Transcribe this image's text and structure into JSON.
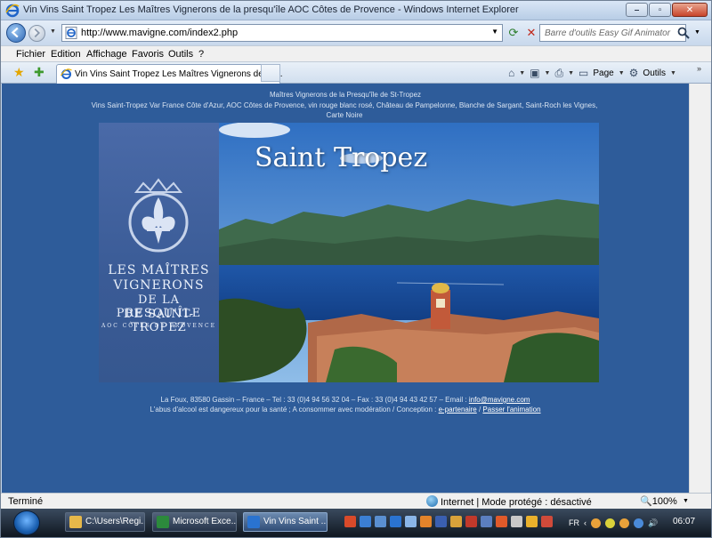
{
  "window": {
    "title": "Vin Vins Saint Tropez Les Maîtres Vignerons de la presqu'île AOC Côtes de Provence - Windows Internet Explorer"
  },
  "address_bar": {
    "url": "http://www.mavigne.com/index2.php",
    "search_placeholder": "Barre d'outils Easy Gif Animator"
  },
  "menu": {
    "items": [
      "Fichier",
      "Edition",
      "Affichage",
      "Favoris",
      "Outils",
      "?"
    ]
  },
  "tabs": {
    "active_label": "Vin Vins Saint Tropez Les Maîtres Vignerons de la ...",
    "page_label": "Page",
    "tools_label": "Outils"
  },
  "page": {
    "header_line1": "Maîtres Vignerons de la Presqu'île de St-Tropez",
    "header_line2": "Vins Saint-Tropez Var France Côte d'Azur, AOC Côtes de Provence, vin rouge blanc rosé, Château de Pampelonne, Blanche de Sargant, Saint-Roch les Vignes, Carte Noire",
    "banner": {
      "brand_line1": "LES MAÎTRES",
      "brand_line2": "VIGNERONS",
      "brand_line3": "DE LA PRESQU'ÎLE",
      "brand_line4": "DE SAINT-TROPEZ",
      "brand_line5": "AOC CÔTES DE PROVENCE",
      "photo_title": "Saint Tropez"
    },
    "footer": {
      "contact_prefix": "La Foux, 83580 Gassin – France – Tel : 33 (0)4 94 56 32 04 – Fax : 33 (0)4 94 43 42 57 – Email : ",
      "email": "info@mavigne.com",
      "legal_prefix": "L'abus d'alcool est dangereux pour la santé ; A consommer avec modération / Conception : ",
      "partner_link": "e-partenaire",
      "separator": " / ",
      "skip_link": "Passer l'animation"
    }
  },
  "status_bar": {
    "status": "Terminé",
    "zone": "Internet | Mode protégé : désactivé",
    "zoom": "100%"
  },
  "taskbar": {
    "buttons": [
      {
        "label": "C:\\Users\\Regi...",
        "icon": "folder-icon"
      },
      {
        "label": "Microsoft Exce...",
        "icon": "excel-icon"
      },
      {
        "label": "Vin Vins Saint ...",
        "icon": "ie-icon"
      }
    ],
    "language": "FR",
    "clock": "06:07"
  },
  "colors": {
    "page_background": "#2e5c9a",
    "banner_left": "#3a5b96",
    "footer_text": "#d9e4f2"
  }
}
